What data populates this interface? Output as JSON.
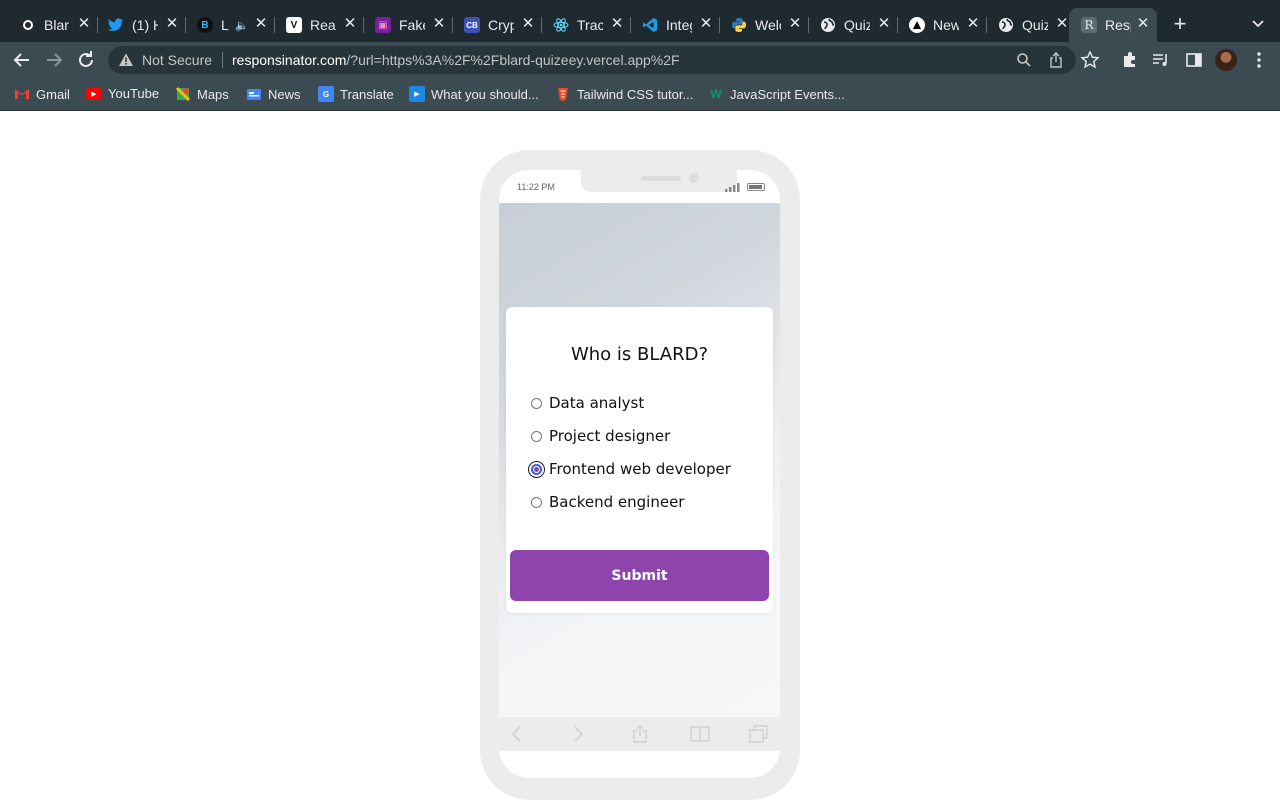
{
  "browser": {
    "tabs": [
      {
        "title": "Blar",
        "icon": "github-icon",
        "color": "#24292f"
      },
      {
        "title": "(1) H",
        "icon": "twitter-icon",
        "color": "#1d9bf0"
      },
      {
        "title": "L",
        "icon": "bitcoin-icon",
        "color": "#111111"
      },
      {
        "title": "Reac",
        "icon": "v-logo-icon",
        "color": "#ffffff"
      },
      {
        "title": "Fake",
        "icon": "app-icon",
        "color": "#c2185b"
      },
      {
        "title": "Cryp",
        "icon": "coin-icon",
        "color": "#3f51b5"
      },
      {
        "title": "Trac",
        "icon": "react-icon",
        "color": "#61dafb"
      },
      {
        "title": "Integ",
        "icon": "vscode-icon",
        "color": "#0078d4"
      },
      {
        "title": "Welc",
        "icon": "python-icon",
        "color": "#3776ab"
      },
      {
        "title": "Quiz",
        "icon": "globe-icon",
        "color": "#ffffff"
      },
      {
        "title": "New",
        "icon": "vercel-icon",
        "color": "#000000"
      },
      {
        "title": "Quiz",
        "icon": "globe-icon",
        "color": "#ffffff"
      },
      {
        "title": "Resp",
        "icon": "r-icon",
        "color": "#5f6b72",
        "active": true
      }
    ],
    "address": {
      "security_label": "Not Secure",
      "host": "responsinator.com",
      "path": "/?url=https%3A%2F%2Fblard-quizeey.vercel.app%2F"
    },
    "bookmarks": [
      {
        "label": "Gmail",
        "icon": "gmail-icon"
      },
      {
        "label": "YouTube",
        "icon": "youtube-icon"
      },
      {
        "label": "Maps",
        "icon": "maps-icon"
      },
      {
        "label": "News",
        "icon": "news-icon"
      },
      {
        "label": "Translate",
        "icon": "translate-icon"
      },
      {
        "label": "What you should...",
        "icon": "play-icon"
      },
      {
        "label": "Tailwind CSS tutor...",
        "icon": "tailwind-icon"
      },
      {
        "label": "JavaScript Events...",
        "icon": "w-icon"
      }
    ]
  },
  "phone": {
    "status_time": "11:22 PM"
  },
  "quiz": {
    "question": "Who is BLARD?",
    "options": [
      {
        "label": "Data analyst",
        "checked": false
      },
      {
        "label": "Project designer",
        "checked": false
      },
      {
        "label": "Frontend web developer",
        "checked": true
      },
      {
        "label": "Backend engineer",
        "checked": false
      }
    ],
    "submit_label": "Submit"
  },
  "colors": {
    "accent": "#8e44ad",
    "chrome_dark": "#1f2a30",
    "chrome": "#3c4a51"
  }
}
